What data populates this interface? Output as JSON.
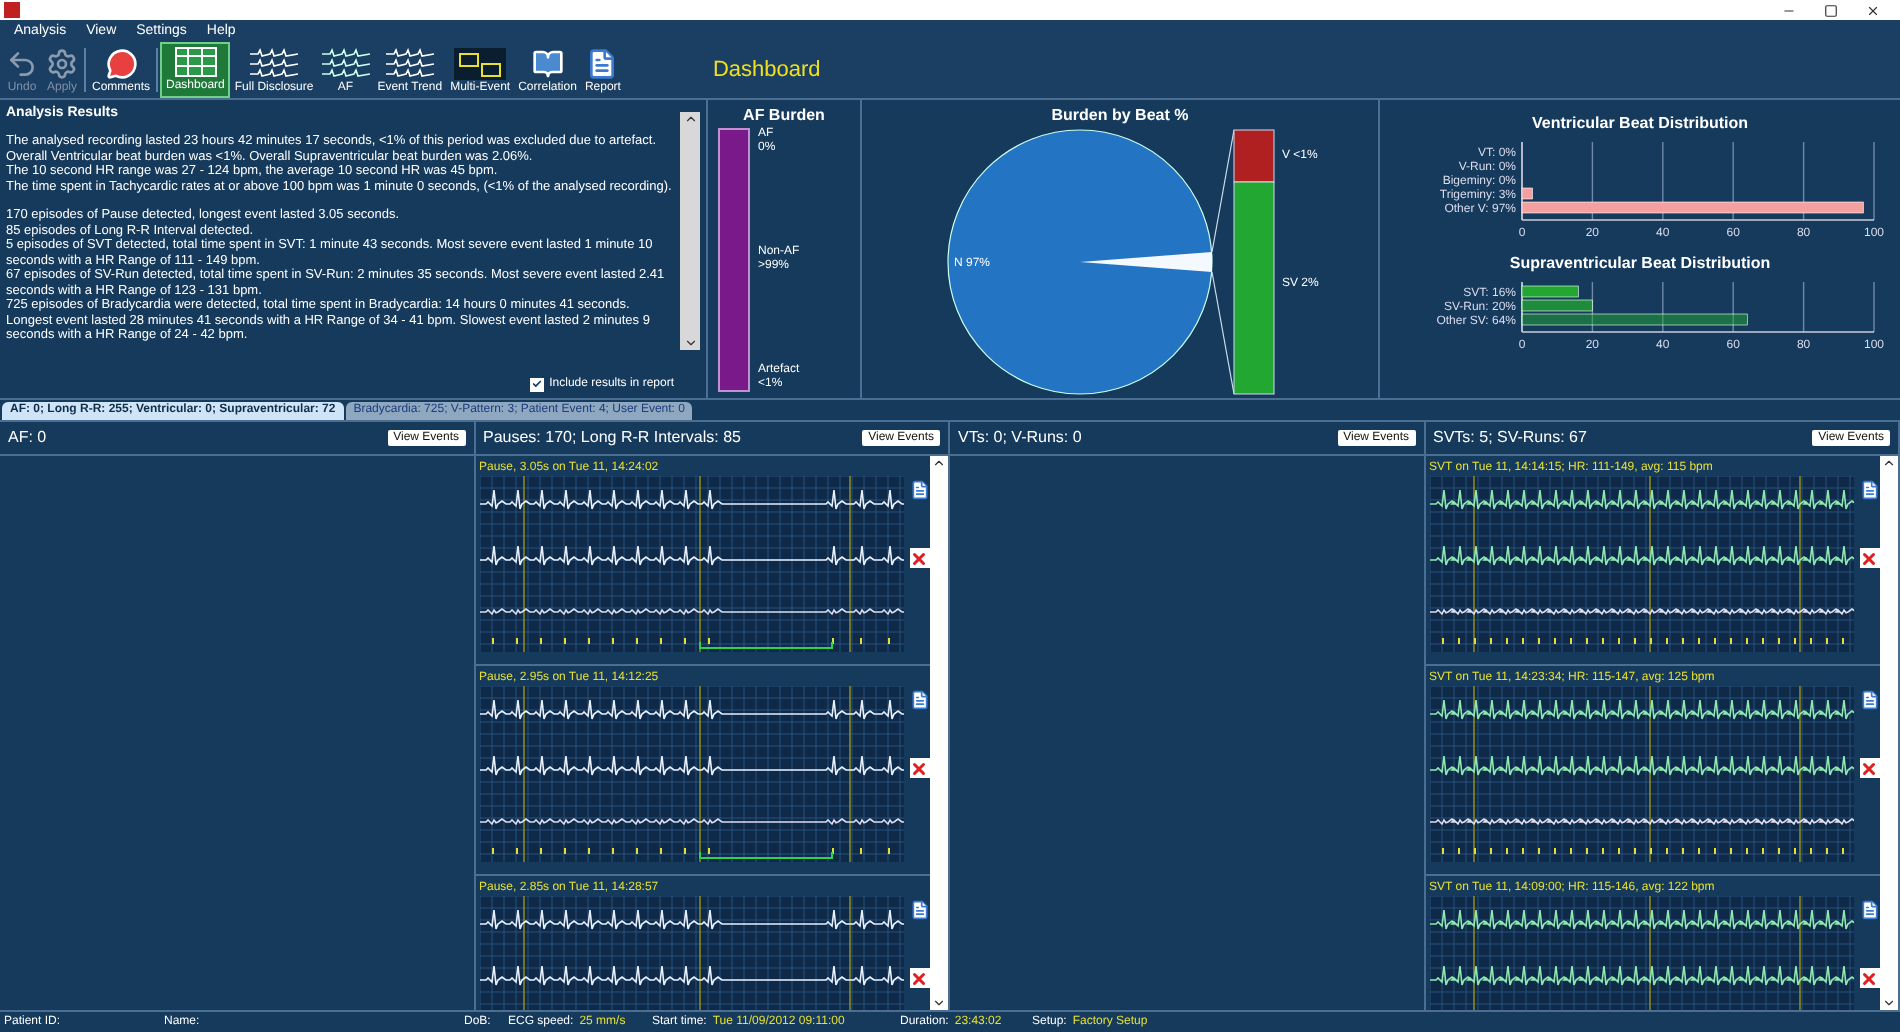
{
  "menu": [
    "Analysis",
    "View",
    "Settings",
    "Help"
  ],
  "toolbar": [
    {
      "label": "Undo",
      "disabled": true,
      "selected": false
    },
    {
      "label": "Apply",
      "disabled": true,
      "selected": false
    },
    {
      "label": "Comments",
      "disabled": false,
      "selected": false
    },
    {
      "label": "Dashboard",
      "disabled": false,
      "selected": true
    },
    {
      "label": "Full Disclosure",
      "disabled": false,
      "selected": false
    },
    {
      "label": "AF",
      "disabled": false,
      "selected": false
    },
    {
      "label": "Event Trend",
      "disabled": false,
      "selected": false
    },
    {
      "label": "Multi-Event",
      "disabled": false,
      "selected": false
    },
    {
      "label": "Correlation",
      "disabled": false,
      "selected": false
    },
    {
      "label": "Report",
      "disabled": false,
      "selected": false
    }
  ],
  "page_title": "Dashboard",
  "analysis": {
    "title": "Analysis Results",
    "paragraphs": [
      [
        "The analysed recording lasted 23 hours 42 minutes 17 seconds, <1% of this period was excluded due to artefact.",
        "Overall Ventricular beat burden was <1%. Overall Supraventricular beat burden was 2.06%.",
        "The 10 second HR range was 27 - 124 bpm, the average 10 second HR was 45 bpm.",
        "The time spent in Tachycardic rates at or above 100 bpm was 1 minute 0 seconds, (<1% of the analysed recording)."
      ],
      [
        "170 episodes of Pause detected, longest event lasted 3.05 seconds.",
        "85 episodes of Long R-R Interval detected.",
        "5 episodes of SVT detected, total time spent in SVT: 1 minute 43 seconds. Most severe event lasted 1 minute 10 seconds with a HR Range of 111 - 149 bpm.",
        "67 episodes of SV-Run detected, total time spent in SV-Run: 2 minutes 35 seconds. Most severe event lasted 2.41 seconds with a HR Range of 123 - 131 bpm.",
        "725 episodes of Bradycardia were detected, total time spent in Bradycardia: 14 hours 0 minutes 41 seconds. Longest event lasted 28 minutes 41 seconds with a HR Range of 34 - 41 bpm. Slowest event lasted 2 minutes 9 seconds with a HR Range of 24 - 42 bpm."
      ]
    ],
    "include_in_report": {
      "label": "Include results in report",
      "checked": true
    }
  },
  "af_burden": {
    "title": "AF Burden",
    "labels": [
      {
        "name": "AF",
        "value": "0%"
      },
      {
        "name": "Non-AF",
        "value": ">99%"
      },
      {
        "name": "Artefact",
        "value": "<1%"
      }
    ]
  },
  "beat_burden": {
    "title": "Burden by Beat %",
    "pie_label": "N 97%",
    "bar_labels": [
      "V <1%",
      "SV 2%"
    ]
  },
  "ventricular": {
    "chart_data": {
      "type": "bar",
      "orientation": "horizontal",
      "title": "Ventricular Beat Distribution",
      "categories": [
        "VT: 0%",
        "V-Run: 0%",
        "Bigeminy: 0%",
        "Trigeminy: 3%",
        "Other V: 97%"
      ],
      "series": [
        {
          "color": "#f4a0a0",
          "values": [
            0,
            0,
            0,
            3,
            97
          ]
        }
      ],
      "grid": true,
      "xlim": [
        0,
        100
      ],
      "xticks": [
        0,
        20,
        40,
        60,
        80,
        100
      ]
    }
  },
  "supraventricular": {
    "chart_data": {
      "type": "bar",
      "orientation": "horizontal",
      "title": "Supraventricular Beat Distribution",
      "categories": [
        "SVT: 16%",
        "SV-Run: 20%",
        "Other SV: 64%"
      ],
      "series": [
        {
          "color": "#22a832",
          "values": [
            16,
            20,
            64
          ]
        }
      ],
      "grid": true,
      "xlim": [
        0,
        100
      ],
      "xticks": [
        0,
        20,
        40,
        60,
        80,
        100
      ]
    }
  },
  "tabs": [
    {
      "label": "AF: 0; Long R-R: 255; Ventricular: 0; Supraventricular: 72",
      "selected": true
    },
    {
      "label": "Bradycardia: 725; V-Pattern: 3; Patient Event: 4; User Event: 0",
      "selected": false
    }
  ],
  "panels": [
    {
      "title": "AF: 0",
      "button": "View Events"
    },
    {
      "title": "Pauses: 170; Long R-R Intervals: 85",
      "button": "View Events",
      "strips": [
        {
          "kind": "pause",
          "label": "Pause, 3.05s on Tue 11, 14:24:02"
        },
        {
          "kind": "pause",
          "label": "Pause, 2.95s on Tue 11, 14:12:25"
        },
        {
          "kind": "pause",
          "label": "Pause, 2.85s on Tue 11, 14:28:57"
        }
      ]
    },
    {
      "title": "VTs: 0; V-Runs: 0",
      "button": "View Events"
    },
    {
      "title": "SVTs: 5; SV-Runs: 67",
      "button": "View Events",
      "strips": [
        {
          "kind": "svt",
          "label": "SVT on Tue 11, 14:14:15; HR: 111-149, avg: 115 bpm"
        },
        {
          "kind": "svt",
          "label": "SVT on Tue 11, 14:23:34; HR: 115-147, avg: 125 bpm"
        },
        {
          "kind": "svt",
          "label": "SVT on Tue 11, 14:09:00; HR: 115-146, avg: 122 bpm"
        }
      ]
    }
  ],
  "status_bar": [
    {
      "label": "Patient ID:"
    },
    {
      "label": "Name:"
    },
    {
      "label": "DoB:"
    },
    {
      "label": "ECG speed:",
      "value": "25 mm/s"
    },
    {
      "label": "Start time:",
      "value": "Tue 11/09/2012 09:11:00"
    },
    {
      "label": "Duration:",
      "value": "23:43:02"
    },
    {
      "label": "Setup:",
      "value": "Factory Setup"
    }
  ]
}
